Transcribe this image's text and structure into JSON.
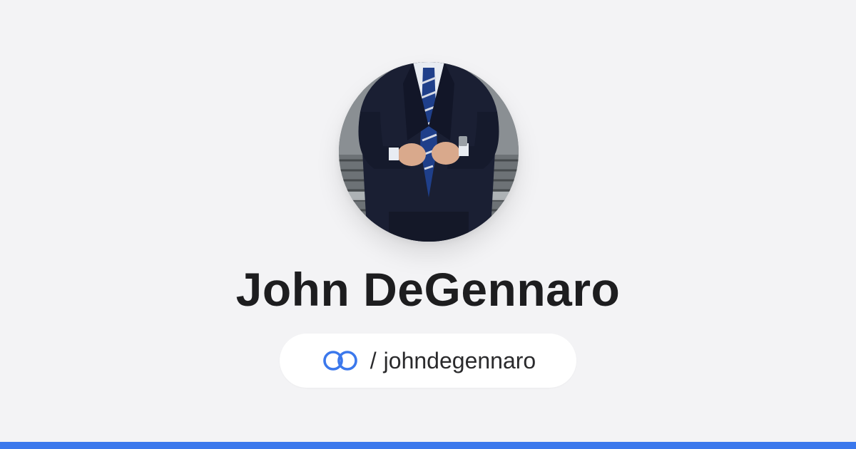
{
  "profile": {
    "name": "John DeGennaro",
    "separator": "/",
    "handle": "johndegennaro",
    "avatar_alt": "suit-photo"
  },
  "icons": {
    "brand_logo": "interlinked-rings-icon"
  },
  "colors": {
    "background": "#f3f3f5",
    "accent": "#3b78ec",
    "text": "#1d1d1f"
  }
}
